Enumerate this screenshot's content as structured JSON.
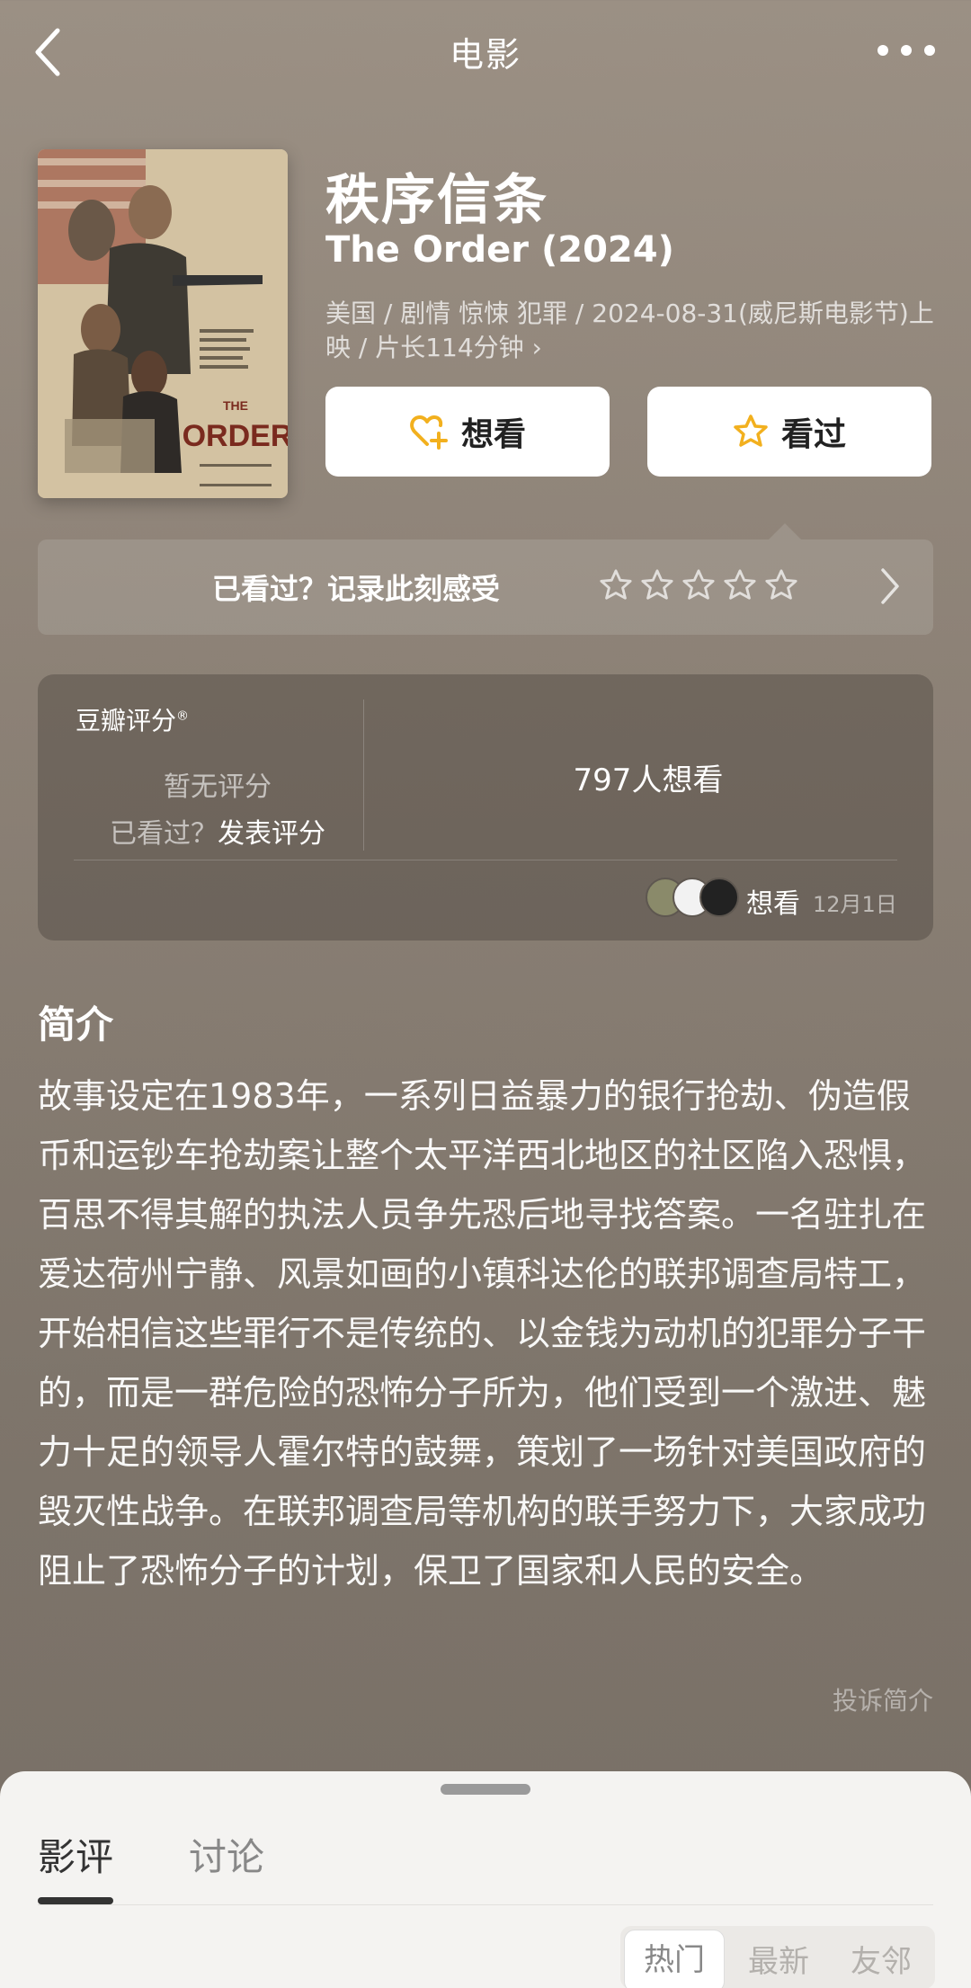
{
  "header": {
    "title": "电影"
  },
  "movie": {
    "title_cn": "秩序信条",
    "title_en": "The Order (2024)",
    "meta": "美国 / 剧情 惊悚 犯罪 / 2024-08-31(威尼斯电影节)上映 / 片长114分钟 ›",
    "poster": {
      "title_text": "THE ORDER"
    }
  },
  "actions": {
    "want_label": "想看",
    "watched_label": "看过"
  },
  "record": {
    "prompt": "已看过？记录此刻感受",
    "stars": 5
  },
  "rating": {
    "brand": "豆瓣评分",
    "brand_mark": "®",
    "no_rating": "暂无评分",
    "prompt_prefix": "已看过？",
    "prompt_action": "发表评分",
    "want_count": "797人想看",
    "friend_status": "想看",
    "friend_date": "12月1日"
  },
  "synopsis": {
    "heading": "简介",
    "body": "故事设定在1983年，一系列日益暴力的银行抢劫、伪造假币和运钞车抢劫案让整个太平洋西北地区的社区陷入恐惧，百思不得其解的执法人员争先恐后地寻找答案。一名驻扎在爱达荷州宁静、风景如画的小镇科达伦的联邦调查局特工，开始相信这些罪行不是传统的、以金钱为动机的犯罪分子干的，而是一群危险的恐怖分子所为，他们受到一个激进、魅力十足的领导人霍尔特的鼓舞，策划了一场针对美国政府的毁灭性战争。在联邦调查局等机构的联手努力下，大家成功阻止了恐怖分子的计划，保卫了国家和人民的安全。",
    "report_label": "投诉简介"
  },
  "sheet": {
    "tabs": [
      "影评",
      "讨论"
    ],
    "active_tab": 0,
    "sort_options": [
      "热门",
      "最新",
      "友邻"
    ],
    "active_sort": 0
  },
  "colors": {
    "accent_star": "#f2b01e",
    "background": "#8c8176"
  }
}
